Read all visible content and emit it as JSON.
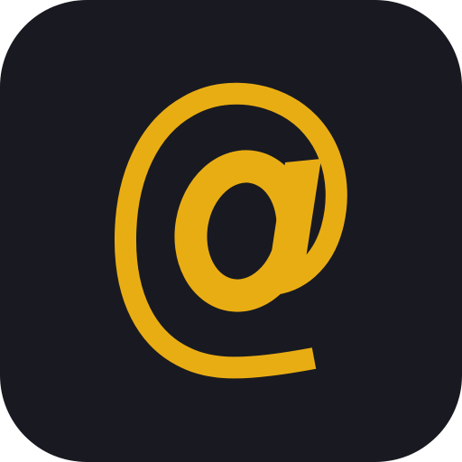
{
  "icon": {
    "name": "at-sign-icon",
    "background_color": "#191a21",
    "glyph_color": "#e9ad14"
  }
}
